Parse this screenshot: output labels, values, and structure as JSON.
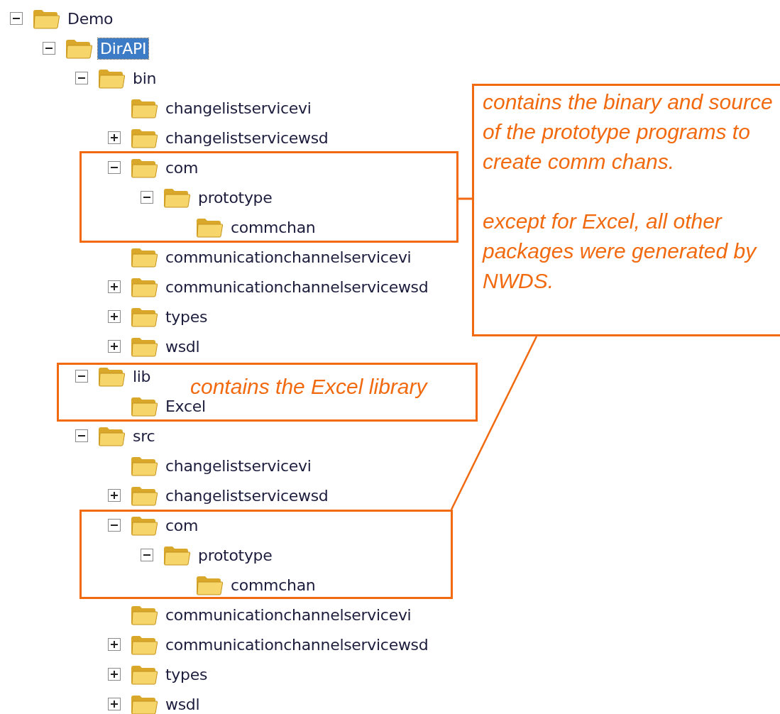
{
  "tree": [
    {
      "label": "Demo",
      "expanded": true,
      "selected": false,
      "children": [
        {
          "label": "DirAPI",
          "expanded": true,
          "selected": true,
          "children": [
            {
              "label": "bin",
              "expanded": true,
              "selected": false,
              "children": [
                {
                  "label": "changelistservicevi",
                  "selected": false
                },
                {
                  "label": "changelistservicewsd",
                  "expanded": false,
                  "selected": false
                },
                {
                  "label": "com",
                  "expanded": true,
                  "selected": false,
                  "children": [
                    {
                      "label": "prototype",
                      "expanded": true,
                      "selected": false,
                      "children": [
                        {
                          "label": "commchan",
                          "selected": false
                        }
                      ]
                    }
                  ]
                },
                {
                  "label": "communicationchannelservicevi",
                  "selected": false
                },
                {
                  "label": "communicationchannelservicewsd",
                  "expanded": false,
                  "selected": false
                },
                {
                  "label": "types",
                  "expanded": false,
                  "selected": false
                },
                {
                  "label": "wsdl",
                  "expanded": false,
                  "selected": false
                }
              ]
            },
            {
              "label": "lib",
              "expanded": true,
              "selected": false,
              "children": [
                {
                  "label": "Excel",
                  "selected": false
                }
              ]
            },
            {
              "label": "src",
              "expanded": true,
              "selected": false,
              "children": [
                {
                  "label": "changelistservicevi",
                  "selected": false
                },
                {
                  "label": "changelistservicewsd",
                  "expanded": false,
                  "selected": false
                },
                {
                  "label": "com",
                  "expanded": true,
                  "selected": false,
                  "children": [
                    {
                      "label": "prototype",
                      "expanded": true,
                      "selected": false,
                      "children": [
                        {
                          "label": "commchan",
                          "selected": false
                        }
                      ]
                    }
                  ]
                },
                {
                  "label": "communicationchannelservicevi",
                  "selected": false
                },
                {
                  "label": "communicationchannelservicewsd",
                  "expanded": false,
                  "selected": false
                },
                {
                  "label": "types",
                  "expanded": false,
                  "selected": false
                },
                {
                  "label": "wsdl",
                  "expanded": false,
                  "selected": false
                }
              ]
            }
          ]
        }
      ]
    }
  ],
  "annotations": [
    {
      "kind": "callout",
      "paragraphs": [
        "contains the binary and source of the prototype programs to create comm chans.",
        "except for Excel, all other packages were generated by NWDS."
      ]
    },
    {
      "kind": "label",
      "text": "contains the Excel library"
    }
  ]
}
